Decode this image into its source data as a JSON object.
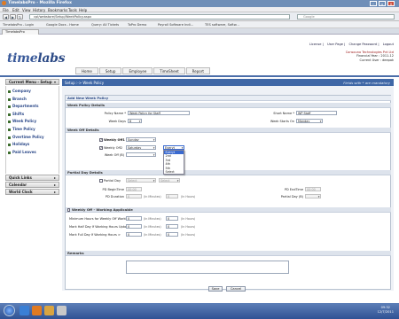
{
  "browser": {
    "window_title": "TimelabsPro - Mozilla Firefox",
    "menu": [
      "File",
      "Edit",
      "View",
      "History",
      "Bookmarks",
      "Tools",
      "Help"
    ],
    "url": "cpl/webstore/Setup/WeekPolicy.aspx",
    "search_placeholder": "Google",
    "bookmarks": [
      "TimelabsPro - Login",
      "Google Docs - Home",
      "Query: All Tickets",
      "ToPro Demo",
      "Payroll Software Indi...",
      "TES software, Softw..."
    ],
    "tab_label": "TimelabsPro"
  },
  "header": {
    "logo_part1": "time",
    "logo_part2": "labs",
    "links": [
      "License",
      "User Page",
      "Change Password",
      "Logout"
    ],
    "company_lines": [
      "Consouno Technologies Pvt Ltd",
      "Financial Year : 2011-12",
      "Current User : deepak"
    ],
    "nav": [
      "Home",
      "Setup",
      "Employee",
      "TimeSheet",
      "Report"
    ]
  },
  "sidebar": {
    "current_menu": "Current Menu - Setup",
    "items": [
      "Company",
      "Branch",
      "Departments",
      "Shifts",
      "Week Policy",
      "Time Policy",
      "Overtime Policy",
      "Holidays",
      "Paid Leaves"
    ],
    "sections": [
      "Quick Links",
      "Calendar",
      "World Clock"
    ]
  },
  "breadcrumb": {
    "path": "Setup :-> Week Policy",
    "mandatory_note": "Fields with * are mandatory"
  },
  "form": {
    "title": "Add New Week Policy",
    "sec_policy": "Week Policy Details",
    "policy_name_label": "Policy Name *",
    "policy_name_value": "Week Policy for Staff",
    "short_name_label": "Short Name *",
    "short_name_value": "WP Staff",
    "week_days_label": "Week Days",
    "week_days_value": "6",
    "week_starts_label": "Week Starts On",
    "week_starts_value": "Monday",
    "sec_weekoff": "Week Off Details",
    "weekly_off1_label": "Weekly Off1",
    "weekly_off1_value": "Sunday",
    "weekly_off2_label": "Weekly Off2",
    "weekly_off2_day": "Saturday",
    "weekly_off2_occurrence": "Everyt",
    "occurrence_options": [
      "Everyt",
      "2nd",
      "3rd",
      "4th",
      "5th",
      "Select"
    ],
    "week_off_b_label": "Week Off (B)",
    "sec_partial": "Partial Day Details",
    "partial_day_label": "Partial Day",
    "partial_day_value": "Select",
    "pd_select": "Select",
    "pd_begin_label": "PD BeginTime",
    "pd_begin_value": "00:00",
    "pd_end_label": "PD EndTime",
    "pd_end_value": "00:00",
    "pd_duration_label": "PD Duration",
    "pd_duration_value": "0",
    "pd_duration_min_note": "(In Minutes)",
    "pd_duration_hr_note": "(In Hours)",
    "pd_duration_hr_value": "0",
    "partial_day_b_label": "Partial Day (B)",
    "sec_weeklyoff_working": "Weekly Off - Working Applicable",
    "min_hours_label": "Minimum Hours for Weekly Off Working :",
    "half_day_label": "Mark Half Day If Working Hours Upto :",
    "full_day_label": "Mark Full Day If Working Hours >",
    "min_hours_value": "0",
    "half_day_value": "0",
    "full_day_value": "0",
    "in_minutes_note": "(In Minutes)",
    "in_hours_note": "(In Hours)",
    "sec_remarks": "Remarks",
    "save_label": "Save",
    "cancel_label": "Cancel"
  },
  "taskbar": {
    "time": "09:32",
    "date": "12/7/2011"
  }
}
